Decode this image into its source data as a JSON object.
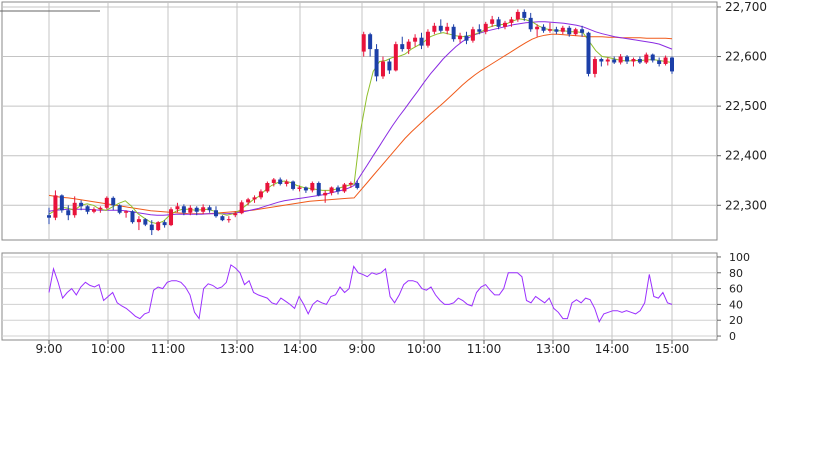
{
  "chart_data": [
    {
      "type": "candlestick",
      "grid": true,
      "ylim": [
        22230,
        22710
      ],
      "y_ticks": [
        22300,
        22400,
        22500,
        22600,
        22700
      ],
      "y_tick_labels": [
        "22,300",
        "22,400",
        "22,500",
        "22,600",
        "22,700"
      ],
      "x_tick_labels": [
        "9:00",
        "10:00",
        "11:00",
        "13:00",
        "14:00",
        "9:00",
        "10:00",
        "11:00",
        "13:00",
        "14:00",
        "15:00"
      ],
      "colors": {
        "up": "#e8133b",
        "down": "#1c3fa8",
        "ma_short": "#8fbf2a",
        "ma_mid": "#8a2be2",
        "ma_long": "#f05a1a"
      },
      "candles": [
        [
          22280,
          22295,
          22262,
          22275
        ],
        [
          22275,
          22330,
          22270,
          22320
        ],
        [
          22320,
          22322,
          22285,
          22290
        ],
        [
          22290,
          22300,
          22270,
          22280
        ],
        [
          22280,
          22318,
          22275,
          22305
        ],
        [
          22305,
          22310,
          22290,
          22298
        ],
        [
          22298,
          22300,
          22282,
          22287
        ],
        [
          22287,
          22296,
          22284,
          22292
        ],
        [
          22292,
          22298,
          22285,
          22295
        ],
        [
          22295,
          22318,
          22292,
          22315
        ],
        [
          22315,
          22318,
          22290,
          22300
        ],
        [
          22300,
          22302,
          22282,
          22285
        ],
        [
          22285,
          22290,
          22275,
          22288
        ],
        [
          22288,
          22290,
          22263,
          22266
        ],
        [
          22266,
          22278,
          22250,
          22272
        ],
        [
          22272,
          22274,
          22258,
          22261
        ],
        [
          22261,
          22270,
          22240,
          22250
        ],
        [
          22250,
          22268,
          22248,
          22266
        ],
        [
          22266,
          22270,
          22255,
          22260
        ],
        [
          22260,
          22296,
          22258,
          22292
        ],
        [
          22292,
          22305,
          22286,
          22298
        ],
        [
          22298,
          22302,
          22280,
          22285
        ],
        [
          22285,
          22300,
          22280,
          22295
        ],
        [
          22295,
          22298,
          22280,
          22287
        ],
        [
          22287,
          22302,
          22282,
          22296
        ],
        [
          22296,
          22300,
          22285,
          22290
        ],
        [
          22290,
          22298,
          22275,
          22278
        ],
        [
          22278,
          22280,
          22268,
          22270
        ],
        [
          22270,
          22278,
          22265,
          22272
        ],
        [
          22280,
          22288,
          22276,
          22284
        ],
        [
          22284,
          22310,
          22282,
          22306
        ],
        [
          22306,
          22315,
          22300,
          22312
        ],
        [
          22312,
          22320,
          22305,
          22316
        ],
        [
          22316,
          22332,
          22312,
          22328
        ],
        [
          22328,
          22348,
          22325,
          22345
        ],
        [
          22345,
          22355,
          22338,
          22352
        ],
        [
          22352,
          22356,
          22340,
          22343
        ],
        [
          22343,
          22352,
          22338,
          22348
        ],
        [
          22348,
          22350,
          22330,
          22333
        ],
        [
          22333,
          22340,
          22328,
          22336
        ],
        [
          22336,
          22338,
          22325,
          22330
        ],
        [
          22330,
          22348,
          22326,
          22345
        ],
        [
          22345,
          22348,
          22318,
          22320
        ],
        [
          22320,
          22330,
          22305,
          22325
        ],
        [
          22325,
          22338,
          22320,
          22336
        ],
        [
          22336,
          22340,
          22322,
          22328
        ],
        [
          22328,
          22345,
          22325,
          22342
        ],
        [
          22342,
          22348,
          22335,
          22345
        ],
        [
          22345,
          22350,
          22332,
          22335
        ],
        [
          22610,
          22650,
          22600,
          22645
        ],
        [
          22645,
          22648,
          22600,
          22615
        ],
        [
          22615,
          22625,
          22550,
          22560
        ],
        [
          22560,
          22600,
          22555,
          22590
        ],
        [
          22590,
          22595,
          22565,
          22572
        ],
        [
          22572,
          22630,
          22570,
          22625
        ],
        [
          22625,
          22640,
          22610,
          22615
        ],
        [
          22615,
          22635,
          22605,
          22630
        ],
        [
          22630,
          22645,
          22620,
          22638
        ],
        [
          22638,
          22648,
          22615,
          22622
        ],
        [
          22622,
          22655,
          22618,
          22650
        ],
        [
          22650,
          22668,
          22645,
          22662
        ],
        [
          22662,
          22675,
          22648,
          22652
        ],
        [
          22652,
          22668,
          22645,
          22660
        ],
        [
          22660,
          22665,
          22630,
          22635
        ],
        [
          22635,
          22648,
          22628,
          22642
        ],
        [
          22642,
          22650,
          22625,
          22632
        ],
        [
          22632,
          22660,
          22628,
          22655
        ],
        [
          22655,
          22665,
          22645,
          22650
        ],
        [
          22650,
          22670,
          22645,
          22666
        ],
        [
          22666,
          22682,
          22660,
          22675
        ],
        [
          22675,
          22680,
          22655,
          22660
        ],
        [
          22660,
          22672,
          22655,
          22668
        ],
        [
          22668,
          22680,
          22660,
          22675
        ],
        [
          22675,
          22695,
          22670,
          22690
        ],
        [
          22690,
          22695,
          22672,
          22678
        ],
        [
          22678,
          22688,
          22650,
          22655
        ],
        [
          22655,
          22665,
          22640,
          22660
        ],
        [
          22660,
          22665,
          22648,
          22652
        ],
        [
          22652,
          22668,
          22648,
          22655
        ],
        [
          22655,
          22660,
          22645,
          22650
        ],
        [
          22650,
          22662,
          22645,
          22658
        ],
        [
          22658,
          22662,
          22640,
          22645
        ],
        [
          22645,
          22658,
          22642,
          22655
        ],
        [
          22655,
          22662,
          22640,
          22648
        ],
        [
          22648,
          22650,
          22560,
          22565
        ],
        [
          22565,
          22600,
          22558,
          22595
        ],
        [
          22595,
          22598,
          22580,
          22590
        ],
        [
          22590,
          22598,
          22582,
          22594
        ],
        [
          22594,
          22600,
          22585,
          22588
        ],
        [
          22588,
          22605,
          22584,
          22600
        ],
        [
          22600,
          22603,
          22585,
          22590
        ],
        [
          22590,
          22598,
          22580,
          22595
        ],
        [
          22595,
          22600,
          22585,
          22588
        ],
        [
          22588,
          22608,
          22585,
          22604
        ],
        [
          22604,
          22606,
          22588,
          22592
        ],
        [
          22592,
          22598,
          22580,
          22585
        ],
        [
          22585,
          22602,
          22582,
          22598
        ],
        [
          22598,
          22600,
          22565,
          22570
        ]
      ],
      "ma_short": [
        22282,
        22290,
        22296,
        22294,
        22290,
        22300,
        22303,
        22300,
        22292,
        22290,
        22297,
        22304,
        22309,
        22298,
        22283,
        22274,
        22266,
        22263,
        22268,
        22280,
        22288,
        22292,
        22292,
        22290,
        22291,
        22292,
        22288,
        22283,
        22280,
        22283,
        22290,
        22300,
        22310,
        22318,
        22330,
        22340,
        22346,
        22349,
        22346,
        22340,
        22336,
        22334,
        22332,
        22330,
        22330,
        22332,
        22336,
        22340,
        22343,
        22450,
        22520,
        22570,
        22590,
        22592,
        22598,
        22600,
        22605,
        22615,
        22622,
        22630,
        22640,
        22645,
        22648,
        22645,
        22642,
        22640,
        22642,
        22645,
        22650,
        22658,
        22662,
        22664,
        22666,
        22672,
        22676,
        22674,
        22670,
        22662,
        22656,
        22654,
        22652,
        22652,
        22650,
        22650,
        22648,
        22630,
        22612,
        22600,
        22598,
        22595,
        22592,
        22591,
        22592,
        22592,
        22593,
        22594,
        22592,
        22590,
        22588
      ],
      "ma_mid": [
        22288,
        22290,
        22291,
        22292,
        22292,
        22292,
        22292,
        22291,
        22290,
        22290,
        22290,
        22290,
        22289,
        22287,
        22285,
        22283,
        22281,
        22280,
        22280,
        22281,
        22282,
        22282,
        22282,
        22282,
        22282,
        22283,
        22283,
        22283,
        22283,
        22284,
        22286,
        22288,
        22291,
        22294,
        22298,
        22302,
        22306,
        22309,
        22311,
        22313,
        22315,
        22317,
        22319,
        22321,
        22324,
        22327,
        22330,
        22334,
        22340,
        22360,
        22380,
        22400,
        22420,
        22440,
        22460,
        22478,
        22495,
        22513,
        22530,
        22548,
        22565,
        22580,
        22595,
        22608,
        22620,
        22630,
        22638,
        22644,
        22648,
        22652,
        22655,
        22658,
        22661,
        22664,
        22666,
        22668,
        22669,
        22670,
        22670,
        22669,
        22668,
        22667,
        22665,
        22663,
        22660,
        22655,
        22650,
        22646,
        22643,
        22640,
        22638,
        22636,
        22634,
        22632,
        22630,
        22628,
        22625,
        22620,
        22615
      ],
      "ma_long": [
        22320,
        22318,
        22316,
        22315,
        22313,
        22311,
        22309,
        22307,
        22305,
        22303,
        22301,
        22299,
        22297,
        22295,
        22293,
        22291,
        22289,
        22288,
        22287,
        22286,
        22285,
        22284,
        22283,
        22283,
        22283,
        22283,
        22284,
        22285,
        22286,
        22287,
        22288,
        22289,
        22290,
        22292,
        22294,
        22296,
        22298,
        22300,
        22302,
        22304,
        22306,
        22308,
        22309,
        22310,
        22311,
        22312,
        22313,
        22314,
        22315,
        22330,
        22345,
        22360,
        22375,
        22390,
        22405,
        22420,
        22435,
        22448,
        22460,
        22472,
        22484,
        22495,
        22506,
        22518,
        22530,
        22542,
        22553,
        22563,
        22572,
        22580,
        22588,
        22596,
        22604,
        22612,
        22620,
        22628,
        22635,
        22640,
        22643,
        22645,
        22645,
        22644,
        22643,
        22642,
        22641,
        22640,
        22640,
        22640,
        22639,
        22639,
        22638,
        22638,
        22638,
        22638,
        22637,
        22637,
        22637,
        22637,
        22636
      ]
    },
    {
      "type": "line",
      "grid": true,
      "ylim": [
        -5,
        105
      ],
      "y_ticks": [
        0,
        20,
        40,
        60,
        80,
        100
      ],
      "y_tick_labels": [
        "0",
        "20",
        "40",
        "60",
        "80",
        "100"
      ],
      "color": "#9b30ff",
      "values": [
        55,
        85,
        68,
        48,
        55,
        60,
        52,
        62,
        68,
        64,
        62,
        65,
        45,
        50,
        55,
        42,
        38,
        35,
        30,
        25,
        22,
        28,
        30,
        58,
        62,
        60,
        68,
        70,
        70,
        68,
        62,
        52,
        30,
        22,
        60,
        66,
        64,
        60,
        62,
        68,
        90,
        86,
        80,
        65,
        70,
        55,
        52,
        50,
        48,
        42,
        40,
        48,
        44,
        40,
        35,
        50,
        40,
        28,
        40,
        45,
        42,
        40,
        50,
        52,
        62,
        55,
        60,
        88,
        80,
        78,
        75,
        80,
        78,
        80,
        85,
        50,
        42,
        52,
        65,
        70,
        70,
        68,
        60,
        58,
        62,
        52,
        45,
        40,
        40,
        42,
        48,
        45,
        40,
        38,
        55,
        62,
        65,
        58,
        52,
        52,
        60,
        80,
        80,
        80,
        75,
        45,
        42,
        50,
        46,
        42,
        48,
        35,
        30,
        22,
        22,
        42,
        46,
        42,
        48,
        46,
        35,
        18,
        28,
        30,
        32,
        32,
        30,
        32,
        30,
        28,
        32,
        42,
        78,
        50,
        48,
        55,
        42,
        40
      ]
    }
  ]
}
